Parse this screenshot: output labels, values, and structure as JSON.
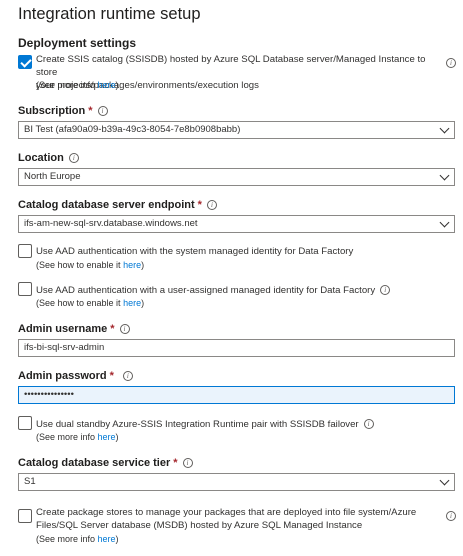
{
  "title": "Integration runtime setup",
  "deployment_settings": "Deployment settings",
  "ssis_checkbox": {
    "checked": true,
    "line1": "Create SSIS catalog (SSISDB) hosted by Azure SQL Database server/Managed Instance to store",
    "line2": "your projects/packages/environments/execution logs",
    "more_prefix": "(See more info ",
    "more_link": "here",
    "more_suffix": ")"
  },
  "subscription": {
    "label": "Subscription",
    "value": "BI Test (afa90a09-b39a-49c3-8054-7e8b0908babb)"
  },
  "location": {
    "label": "Location",
    "value": "North Europe"
  },
  "endpoint": {
    "label": "Catalog database server endpoint",
    "value": "ifs-am-new-sql-srv.database.windows.net"
  },
  "aad_system": {
    "checked": false,
    "text": "Use AAD authentication with the system managed identity for Data Factory",
    "more_prefix": "(See how to enable it ",
    "more_link": "here",
    "more_suffix": ")"
  },
  "aad_user": {
    "checked": false,
    "text": "Use AAD authentication with a user-assigned managed identity for Data Factory",
    "more_prefix": "(See how to enable it ",
    "more_link": "here",
    "more_suffix": ")"
  },
  "admin_username": {
    "label": "Admin username",
    "value": "ifs-bi-sql-srv-admin"
  },
  "admin_password": {
    "label": "Admin password",
    "value": "•••••••••••••••"
  },
  "dual_standby": {
    "checked": false,
    "text": "Use dual standby Azure-SSIS Integration Runtime pair with SSISDB failover",
    "more_prefix": "(See more info ",
    "more_link": "here",
    "more_suffix": ")"
  },
  "service_tier": {
    "label": "Catalog database service tier",
    "value": "S1"
  },
  "package_stores": {
    "checked": false,
    "line1": "Create package stores to manage your packages that are deployed into file system/Azure",
    "line2": "Files/SQL Server database (MSDB) hosted by Azure SQL Managed Instance",
    "more_prefix": "(See more info ",
    "more_link": "here",
    "more_suffix": ")"
  },
  "required_mark": "*",
  "info_glyph": "i",
  "colors": {
    "accent": "#0078d4",
    "required": "#a4262c"
  },
  "icons": {
    "info": "info-icon",
    "chevron": "chevron-down-icon",
    "check": "checkmark-icon"
  }
}
